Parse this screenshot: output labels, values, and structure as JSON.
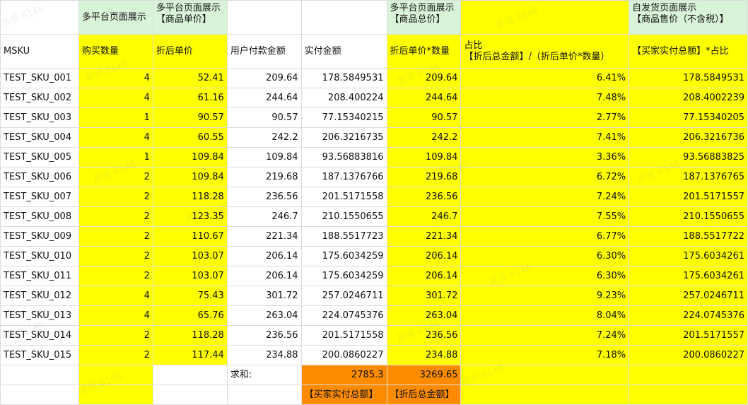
{
  "colors": {
    "yellow": "#ffff00",
    "green": "#d9f3d9",
    "orange": "#ff8c00"
  },
  "header1": {
    "c2": "多平台页面展示",
    "c3a": "多平台页面展示",
    "c3b": "【商品单价】",
    "c7a": "多平台页面展示",
    "c7b": "【商品总价】",
    "c9a": "自发货页面展示",
    "c9b": "【商品售价（不含税）】"
  },
  "header2": {
    "c1": "MSKU",
    "c2": "购买数量",
    "c3": "折后单价",
    "c4": "用户付款金额",
    "c5": "实付金额",
    "c7": "折后单价*数量",
    "c8a": "占比",
    "c8b": "【折后总金额】/（折后单价*数量）",
    "c9": "【买家实付总额】*占比"
  },
  "rows": [
    {
      "msku": "TEST_SKU_001",
      "qty": "4",
      "unit": "52.41",
      "pay": "209.64",
      "paid": "178.5849531",
      "total": "209.64",
      "ratio": "6.41%",
      "sale": "178.5849531"
    },
    {
      "msku": "TEST_SKU_002",
      "qty": "4",
      "unit": "61.16",
      "pay": "244.64",
      "paid": "208.400224",
      "total": "244.64",
      "ratio": "7.48%",
      "sale": "208.4002239"
    },
    {
      "msku": "TEST_SKU_003",
      "qty": "1",
      "unit": "90.57",
      "pay": "90.57",
      "paid": "77.15340215",
      "total": "90.57",
      "ratio": "2.77%",
      "sale": "77.15340205"
    },
    {
      "msku": "TEST_SKU_004",
      "qty": "4",
      "unit": "60.55",
      "pay": "242.2",
      "paid": "206.3216735",
      "total": "242.2",
      "ratio": "7.41%",
      "sale": "206.3216736"
    },
    {
      "msku": "TEST_SKU_005",
      "qty": "1",
      "unit": "109.84",
      "pay": "109.84",
      "paid": "93.56883816",
      "total": "109.84",
      "ratio": "3.36%",
      "sale": "93.56883825"
    },
    {
      "msku": "TEST_SKU_006",
      "qty": "2",
      "unit": "109.84",
      "pay": "219.68",
      "paid": "187.1376766",
      "total": "219.68",
      "ratio": "6.72%",
      "sale": "187.1376765"
    },
    {
      "msku": "TEST_SKU_007",
      "qty": "2",
      "unit": "118.28",
      "pay": "236.56",
      "paid": "201.5171558",
      "total": "236.56",
      "ratio": "7.24%",
      "sale": "201.5171557"
    },
    {
      "msku": "TEST_SKU_008",
      "qty": "2",
      "unit": "123.35",
      "pay": "246.7",
      "paid": "210.1550655",
      "total": "246.7",
      "ratio": "7.55%",
      "sale": "210.1550655"
    },
    {
      "msku": "TEST_SKU_009",
      "qty": "2",
      "unit": "110.67",
      "pay": "221.34",
      "paid": "188.5517723",
      "total": "221.34",
      "ratio": "6.77%",
      "sale": "188.5517722"
    },
    {
      "msku": "TEST_SKU_010",
      "qty": "2",
      "unit": "103.07",
      "pay": "206.14",
      "paid": "175.6034259",
      "total": "206.14",
      "ratio": "6.30%",
      "sale": "175.6034261"
    },
    {
      "msku": "TEST_SKU_011",
      "qty": "2",
      "unit": "103.07",
      "pay": "206.14",
      "paid": "175.6034259",
      "total": "206.14",
      "ratio": "6.30%",
      "sale": "175.6034261"
    },
    {
      "msku": "TEST_SKU_012",
      "qty": "4",
      "unit": "75.43",
      "pay": "301.72",
      "paid": "257.0246711",
      "total": "301.72",
      "ratio": "9.23%",
      "sale": "257.0246711"
    },
    {
      "msku": "TEST_SKU_013",
      "qty": "4",
      "unit": "65.76",
      "pay": "263.04",
      "paid": "224.0745376",
      "total": "263.04",
      "ratio": "8.04%",
      "sale": "224.0745376"
    },
    {
      "msku": "TEST_SKU_014",
      "qty": "2",
      "unit": "118.28",
      "pay": "236.56",
      "paid": "201.5171558",
      "total": "236.56",
      "ratio": "7.24%",
      "sale": "201.5171557"
    },
    {
      "msku": "TEST_SKU_015",
      "qty": "2",
      "unit": "117.44",
      "pay": "234.88",
      "paid": "200.0860227",
      "total": "234.88",
      "ratio": "7.18%",
      "sale": "200.0860227"
    }
  ],
  "sum_row": {
    "label": "求和:",
    "paid_total": "2785.3",
    "discount_total": "3269.65"
  },
  "footer_row": {
    "paid_label": "【买家实付总额】",
    "discount_label": "【折后总金额】"
  },
  "watermark_text": "易贸 6146"
}
